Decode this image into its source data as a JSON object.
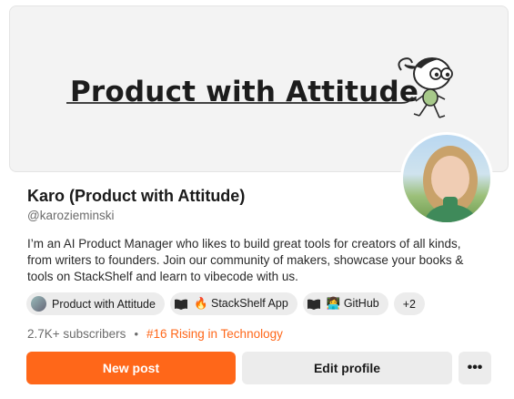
{
  "banner": {
    "title": "Product with Attitude",
    "bg_color": "#f3f3f3",
    "mascot_icon": "cartoon-mascot-icon"
  },
  "profile": {
    "name": "Karo (Product with Attitude)",
    "handle": "@karozieminski",
    "bio": "I’m an AI Product Manager who likes to build great tools for creators of all kinds, from writers to founders. Join our community of makers, showcase your books & tools on StackShelf and learn to vibecode with us.",
    "avatar_icon": "profile-photo"
  },
  "chips": [
    {
      "label": "Product with Attitude",
      "icon": "publication-avatar-icon"
    },
    {
      "label": "🔥 StackShelf App",
      "icon": "book-icon"
    },
    {
      "label": "👩‍💻 GitHub",
      "icon": "book-icon"
    },
    {
      "label": "+2"
    }
  ],
  "stats": {
    "subscribers": "2.7K+ subscribers",
    "separator": "•",
    "rank": "#16 Rising in Technology"
  },
  "actions": {
    "new_post": "New post",
    "edit_profile": "Edit profile",
    "more": "•••"
  },
  "colors": {
    "accent": "#ff6719",
    "chip_bg": "#ececec",
    "muted_text": "#6b6b6b"
  }
}
